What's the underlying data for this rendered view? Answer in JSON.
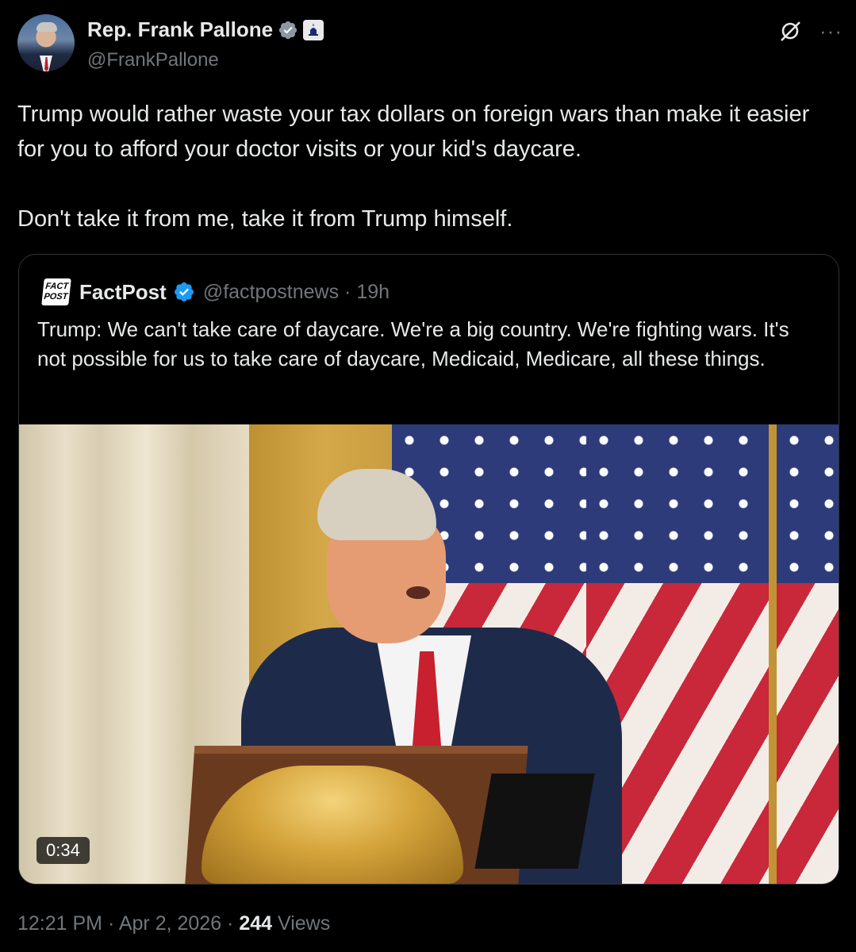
{
  "author": {
    "display_name": "Rep. Frank Pallone",
    "handle": "@FrankPallone",
    "verified_icon": "verified-badge-icon",
    "affiliation_icon": "capitol-building-icon"
  },
  "actions": {
    "grok_icon": "grok-icon",
    "more_label": "···"
  },
  "tweet": {
    "text": "Trump would rather waste your tax dollars on foreign wars than make it easier for you to afford your doctor visits or your kid's daycare.\n\nDon't take it from me, take it from Trump himself."
  },
  "quote": {
    "logo_line1": "FACT",
    "logo_line2": "POST",
    "name": "FactPost",
    "handle_time": "@factpostnews · 19h",
    "text": "Trump: We can't take care of daycare. We're a big country. We're fighting wars. It's not possible for us to take care of daycare, Medicaid, Medicare, all these things.",
    "video_duration": "0:34"
  },
  "footer": {
    "time_date": "12:21 PM · Apr 2, 2026 · ",
    "views_count": "244",
    "views_label": " Views"
  },
  "colors": {
    "background": "#000000",
    "text": "#e7e9ea",
    "muted": "#71767b",
    "verified_blue": "#1d9bf0",
    "border": "#2f3336"
  }
}
